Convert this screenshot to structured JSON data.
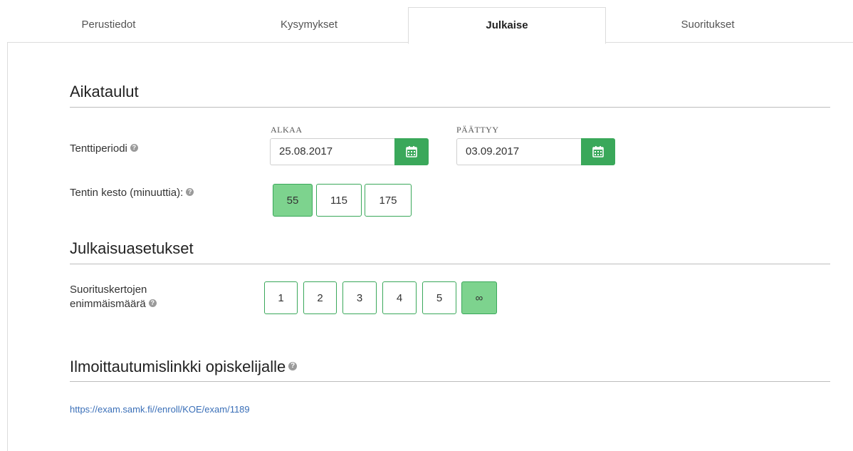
{
  "tabs": [
    {
      "label": "Perustiedot"
    },
    {
      "label": "Kysymykset"
    },
    {
      "label": "Julkaise"
    },
    {
      "label": "Suoritukset"
    }
  ],
  "active_tab": "Julkaise",
  "schedules": {
    "title": "Aikataulut",
    "period_label": "Tenttiperiodi",
    "start_caption": "ALKAA",
    "start_value": "25.08.2017",
    "end_caption": "PÄÄTTYY",
    "end_value": "03.09.2017",
    "duration_label": "Tentin kesto (minuuttia):",
    "durations": [
      "55",
      "115",
      "175"
    ],
    "selected_duration": "55"
  },
  "publish_settings": {
    "title": "Julkaisuasetukset",
    "attempts_label_line1": "Suorituskertojen",
    "attempts_label_line2": "enimmäismäärä",
    "attempts": [
      "1",
      "2",
      "3",
      "4",
      "5",
      "∞"
    ],
    "selected_attempt": "∞"
  },
  "enrollment": {
    "title": "Ilmoittautumislinkki opiskelijalle",
    "link": "https://exam.samk.fi//enroll/KOE/exam/1189"
  },
  "colors": {
    "accent": "#3aa85a",
    "selected": "#7dd38e",
    "link": "#3a6fb8"
  }
}
